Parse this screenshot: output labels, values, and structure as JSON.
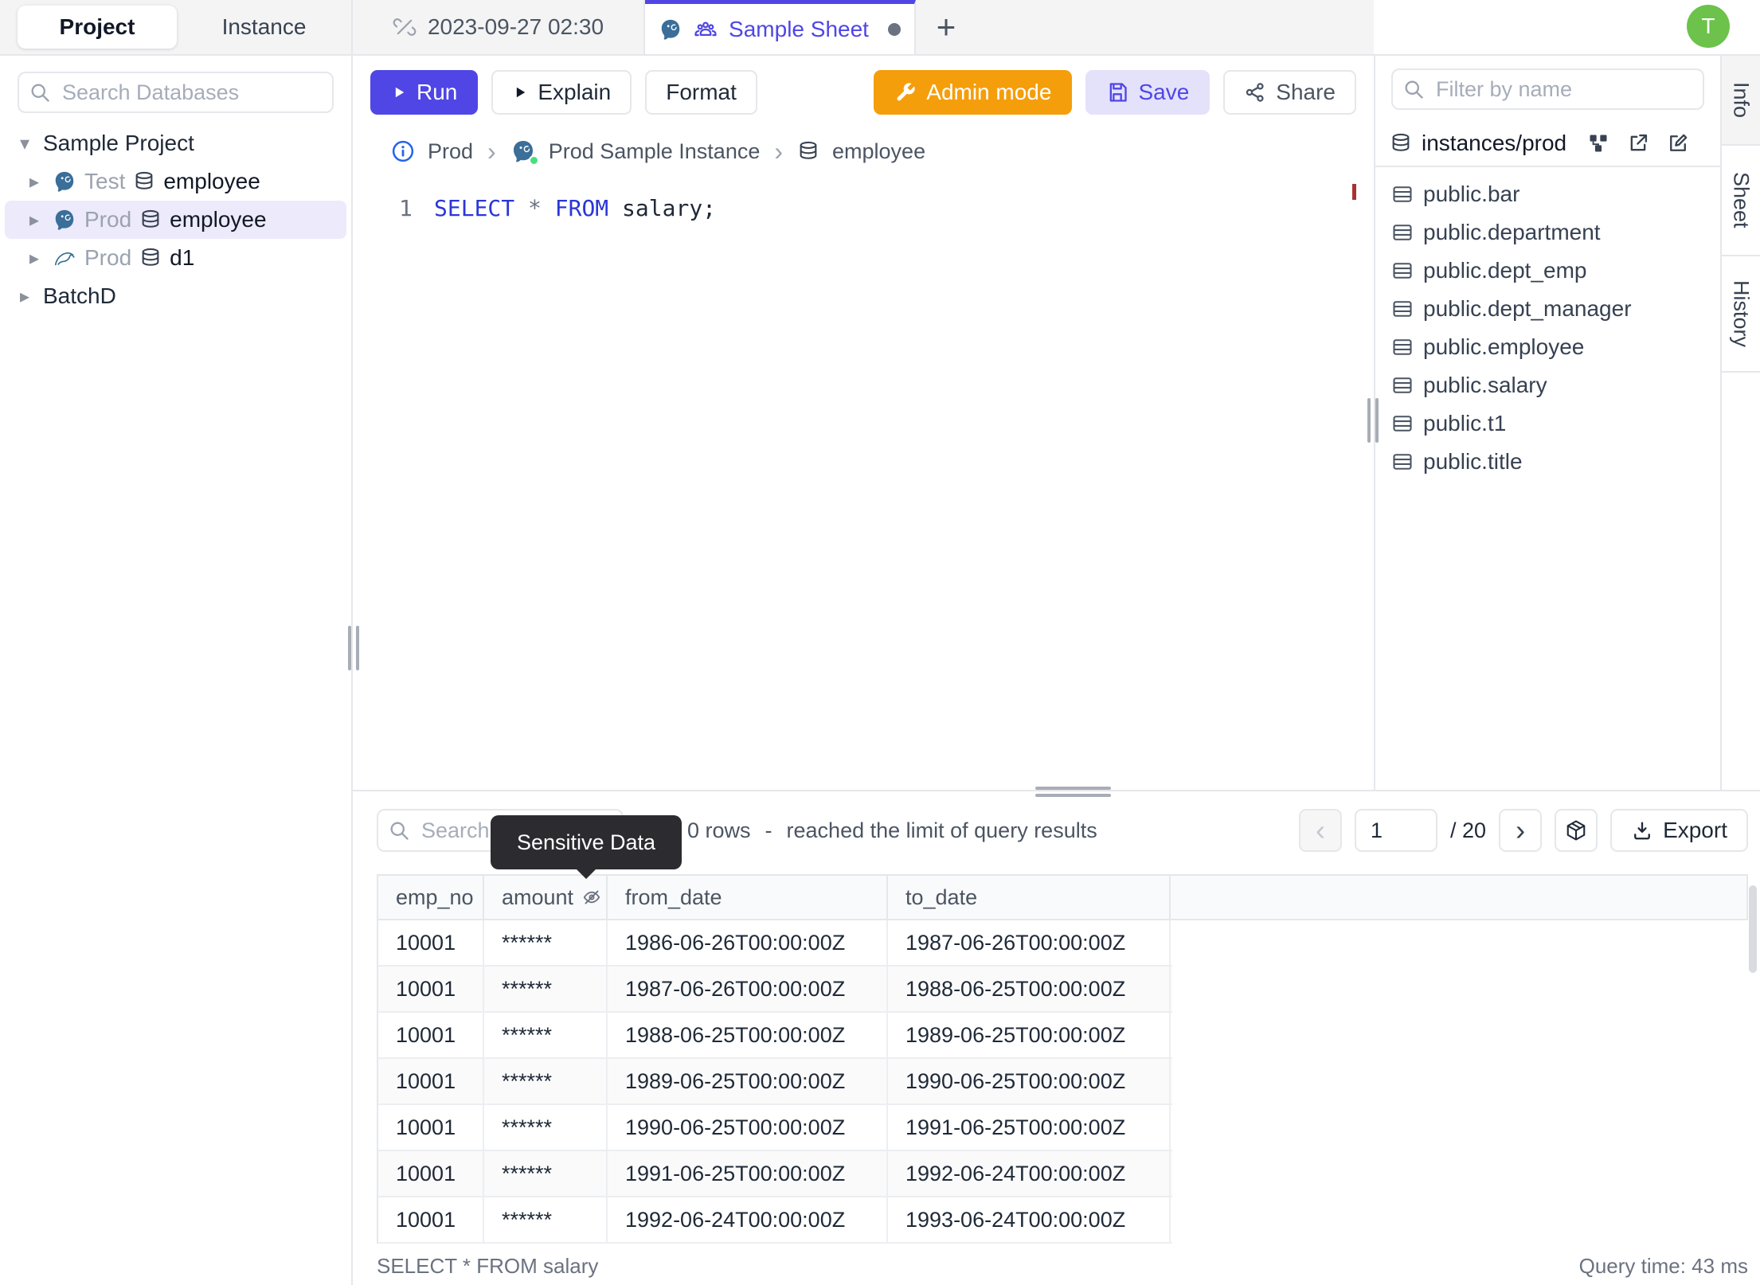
{
  "header": {
    "avatar": "T"
  },
  "icons": {
    "add": "+",
    "caret_down": "▾",
    "caret_right": "▸",
    "chevron_left": "‹",
    "chevron_right": "›",
    "breadcrumb_separator": "›"
  },
  "left_sidebar": {
    "tabs": [
      {
        "label": "Project",
        "active": true
      },
      {
        "label": "Instance",
        "active": false
      }
    ],
    "search_placeholder": "Search Databases",
    "tree": {
      "project": "Sample Project",
      "items": [
        {
          "env": "Test",
          "engine": "postgres",
          "database": "employee",
          "selected": false
        },
        {
          "env": "Prod",
          "engine": "postgres",
          "database": "employee",
          "selected": true
        },
        {
          "env": "Prod",
          "engine": "mysql",
          "database": "d1",
          "selected": false
        }
      ],
      "collapsed_project": "BatchD"
    }
  },
  "tab_bar": {
    "tabs": [
      {
        "label": "2023-09-27 02:30",
        "active": false
      },
      {
        "label": "Sample Sheet",
        "active": true,
        "dirty": true
      }
    ]
  },
  "toolbar": {
    "run": "Run",
    "explain": "Explain",
    "format": "Format",
    "admin_mode": "Admin mode",
    "save": "Save",
    "share": "Share"
  },
  "breadcrumb": {
    "environment": "Prod",
    "instance": "Prod Sample Instance",
    "database": "employee"
  },
  "editor": {
    "line_number": "1",
    "keyword_select": "SELECT",
    "operator_star": "*",
    "keyword_from": "FROM",
    "identifier": "salary;"
  },
  "right_sidebar": {
    "filter_placeholder": "Filter by name",
    "schema_header": "instances/prod",
    "tables": [
      "public.bar",
      "public.department",
      "public.dept_emp",
      "public.dept_manager",
      "public.employee",
      "public.salary",
      "public.t1",
      "public.title"
    ]
  },
  "side_tabs": [
    {
      "label": "Info",
      "active": true
    },
    {
      "label": "Sheet",
      "active": false
    },
    {
      "label": "History",
      "active": false
    }
  ],
  "results": {
    "search_placeholder": "Search",
    "tooltip": "Sensitive Data",
    "rows_count_text": "0 rows",
    "separator": "-",
    "limit_message": "reached the limit of query results",
    "pagination": {
      "page": "1",
      "total": "/ 20"
    },
    "export_label": "Export",
    "table": {
      "headers": [
        "emp_no",
        "amount",
        "from_date",
        "to_date"
      ],
      "rows": [
        [
          "10001",
          "******",
          "1986-06-26T00:00:00Z",
          "1987-06-26T00:00:00Z"
        ],
        [
          "10001",
          "******",
          "1987-06-26T00:00:00Z",
          "1988-06-25T00:00:00Z"
        ],
        [
          "10001",
          "******",
          "1988-06-25T00:00:00Z",
          "1989-06-25T00:00:00Z"
        ],
        [
          "10001",
          "******",
          "1989-06-25T00:00:00Z",
          "1990-06-25T00:00:00Z"
        ],
        [
          "10001",
          "******",
          "1990-06-25T00:00:00Z",
          "1991-06-25T00:00:00Z"
        ],
        [
          "10001",
          "******",
          "1991-06-25T00:00:00Z",
          "1992-06-24T00:00:00Z"
        ],
        [
          "10001",
          "******",
          "1992-06-24T00:00:00Z",
          "1993-06-24T00:00:00Z"
        ]
      ]
    },
    "status_query": "SELECT * FROM salary",
    "query_time": "Query time: 43 ms"
  },
  "colors": {
    "accent": "#4f46e5",
    "admin_orange": "#f59e0b",
    "avatar_green": "#6cc24a",
    "selected_row": "#eceafb",
    "status_green": "#4ade80"
  }
}
